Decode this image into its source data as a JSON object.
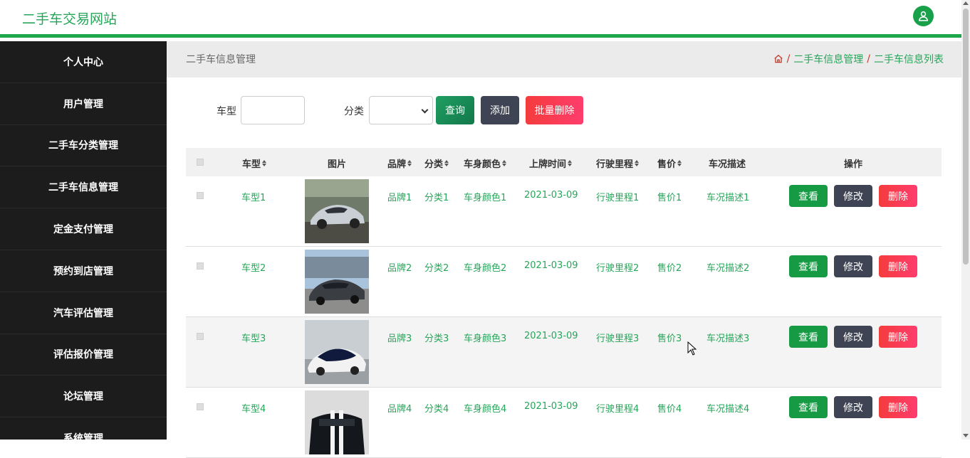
{
  "header": {
    "title": "二手车交易网站",
    "avatar_icon": "user-icon"
  },
  "sidebar": {
    "items": [
      {
        "label": "个人中心"
      },
      {
        "label": "用户管理"
      },
      {
        "label": "二手车分类管理"
      },
      {
        "label": "二手车信息管理"
      },
      {
        "label": "定金支付管理"
      },
      {
        "label": "预约到店管理"
      },
      {
        "label": "汽车评估管理"
      },
      {
        "label": "评估报价管理"
      },
      {
        "label": "论坛管理"
      },
      {
        "label": "系统管理"
      }
    ]
  },
  "page": {
    "title": "二手车信息管理",
    "breadcrumb": {
      "home_icon": "home-icon",
      "sep": "/",
      "items": [
        "二手车信息管理",
        "二手车信息列表"
      ]
    }
  },
  "search": {
    "model_label": "车型",
    "model_value": "",
    "category_label": "分类",
    "category_value": "",
    "query_label": "查询",
    "add_label": "添加",
    "batch_delete_label": "批量删除"
  },
  "table": {
    "headers": {
      "model": "车型",
      "image": "图片",
      "brand": "品牌",
      "category": "分类",
      "color": "车身颜色",
      "date": "上牌时间",
      "mileage": "行驶里程",
      "price": "售价",
      "condition": "车况描述",
      "actions": "操作"
    },
    "action_labels": {
      "view": "查看",
      "edit": "修改",
      "delete": "删除"
    },
    "rows": [
      {
        "model": "车型1",
        "brand": "品牌1",
        "category": "分类1",
        "color": "车身颜色1",
        "date": "2021-03-09",
        "mileage": "行驶里程1",
        "price": "售价1",
        "condition": "车况描述1"
      },
      {
        "model": "车型2",
        "brand": "品牌2",
        "category": "分类2",
        "color": "车身颜色2",
        "date": "2021-03-09",
        "mileage": "行驶里程2",
        "price": "售价2",
        "condition": "车况描述2"
      },
      {
        "model": "车型3",
        "brand": "品牌3",
        "category": "分类3",
        "color": "车身颜色3",
        "date": "2021-03-09",
        "mileage": "行驶里程3",
        "price": "售价3",
        "condition": "车况描述3"
      },
      {
        "model": "车型4",
        "brand": "品牌4",
        "category": "分类4",
        "color": "车身颜色4",
        "date": "2021-03-09",
        "mileage": "行驶里程4",
        "price": "售价4",
        "condition": "车况描述4"
      }
    ]
  },
  "colors": {
    "accent": "#1ea64b",
    "sidebar_bg": "#1c1c1c",
    "link": "#27a55a",
    "danger": "#f43c3c",
    "dark_button": "#3e4454"
  }
}
